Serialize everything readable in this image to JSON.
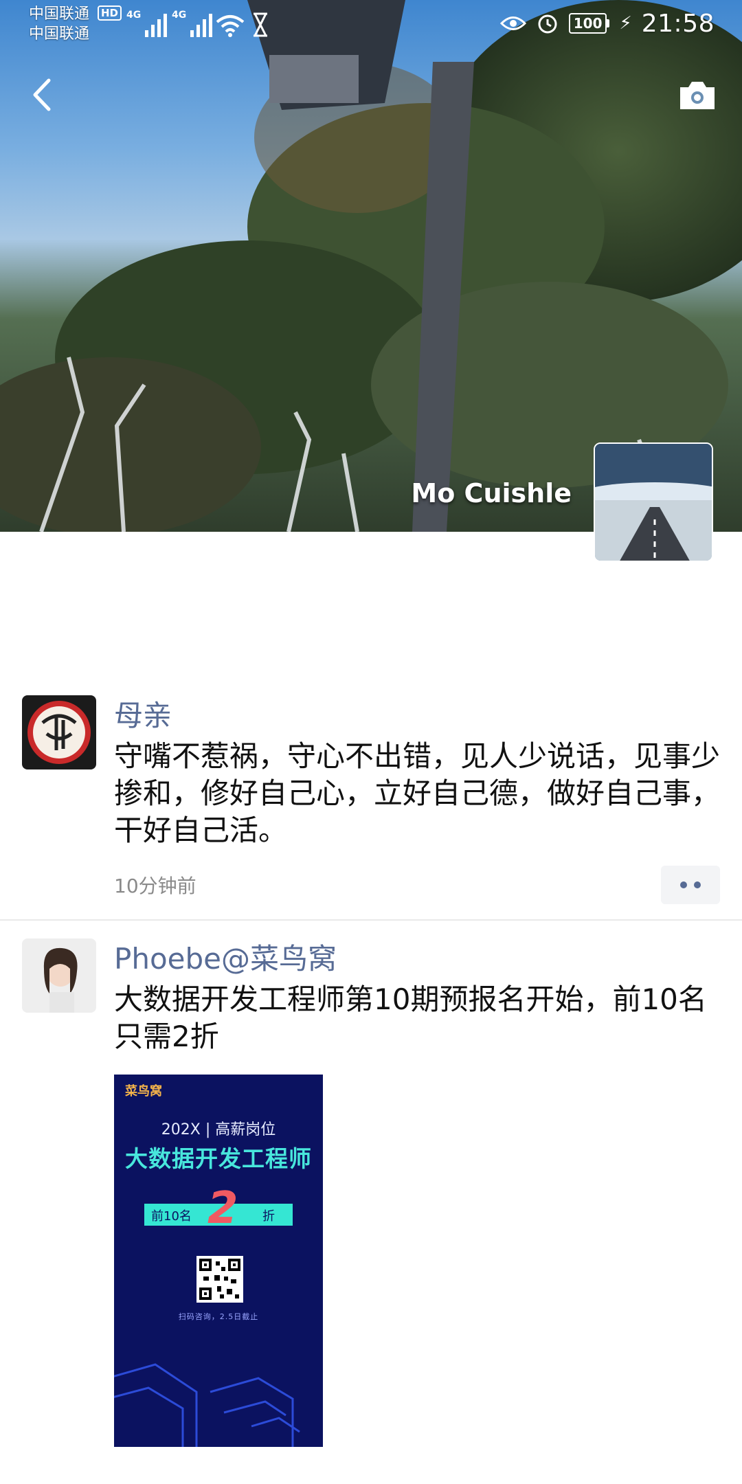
{
  "status_bar": {
    "carrier_1": "中国联通",
    "carrier_2": "中国联通",
    "hd_badge": "HD",
    "network_1": "4G",
    "network_2": "4G",
    "battery": "100",
    "time": "21:58"
  },
  "header": {
    "profile_name": "Mo Cuishle"
  },
  "posts": [
    {
      "author": "母亲",
      "text": "守嘴不惹祸，守心不出错，见人少说话，见事少掺和，修好自己心，立好自己德，做好自己事，干好自己活。",
      "time": "10分钟前"
    },
    {
      "author": "Phoebe@菜鸟窝",
      "text": "大数据开发工程师第10期预报名开始，前10名只需2折",
      "poster": {
        "logo": "菜鸟窝",
        "subtitle": "202X | 高薪岗位",
        "headline": "大数据开发工程师",
        "offer_left": "前10名",
        "offer_number": "2",
        "offer_right": "折",
        "caption": "扫码咨询，2.5日截止"
      }
    }
  ],
  "colors": {
    "author_link": "#576b95",
    "time_gray": "#8a8a8a",
    "poster_bg": "#0b1260",
    "poster_accent": "#35e6d3",
    "poster_number": "#f05a62"
  }
}
